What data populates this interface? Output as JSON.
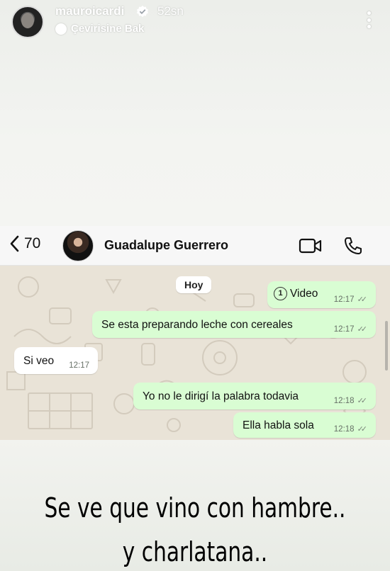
{
  "story": {
    "username": "mauroicardi",
    "time_ago": "52sn",
    "translate_label": "Çevirisine Bak",
    "verified_icon": "verified-badge-icon",
    "more_icon": "more-vertical-icon"
  },
  "chat": {
    "back_count": "70",
    "contact_name": "Guadalupe Guerrero",
    "day_label": "Hoy",
    "messages": [
      {
        "direction": "outgoing",
        "kind": "view-once-video",
        "text": "Video",
        "time": "12:17",
        "status": "read"
      },
      {
        "direction": "outgoing",
        "text": "Se esta preparando leche con cereales",
        "time": "12:17",
        "status": "read"
      },
      {
        "direction": "incoming",
        "text": "Si veo",
        "time": "12:17"
      },
      {
        "direction": "outgoing",
        "text": "Yo no le dirigí la palabra todavia",
        "time": "12:18",
        "status": "read"
      },
      {
        "direction": "outgoing",
        "text": "Ella habla sola",
        "time": "12:18",
        "status": "read"
      }
    ],
    "view_once_glyph": "1",
    "colors": {
      "outgoing_bubble": "#d9fdd3",
      "incoming_bubble": "#ffffff",
      "wallpaper": "#e9e3d7"
    }
  },
  "caption": {
    "line1": "Se ve que vino con hambre..",
    "line2": "y charlatana.."
  }
}
